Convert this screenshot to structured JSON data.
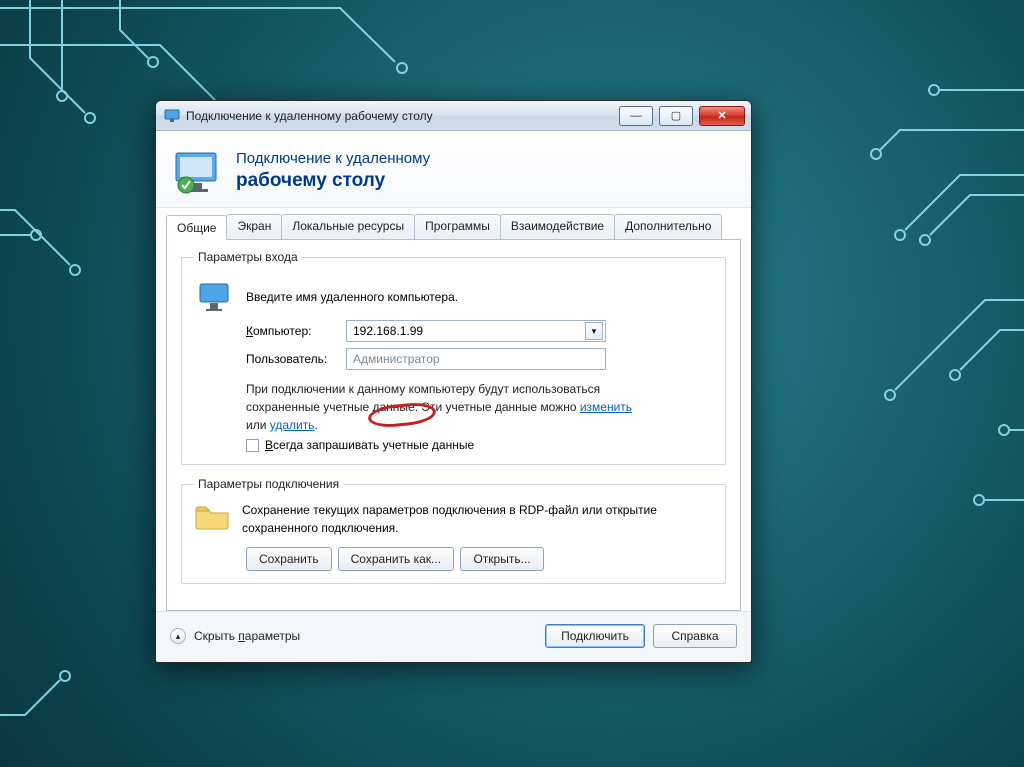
{
  "window": {
    "title": "Подключение к удаленному рабочему столу"
  },
  "header": {
    "line1": "Подключение к удаленному",
    "line2": "рабочему столу"
  },
  "tabs": {
    "general": "Общие",
    "display": "Экран",
    "local": "Локальные ресурсы",
    "programs": "Программы",
    "experience": "Взаимодействие",
    "advanced": "Дополнительно"
  },
  "login": {
    "legend": "Параметры входа",
    "instruction": "Введите имя удаленного компьютера.",
    "computer_label_pre": "К",
    "computer_label_rest": "омпьютер:",
    "computer_value": "192.168.1.99",
    "user_label": "Пользователь:",
    "user_value": "Администратор",
    "info_pre": "При подключении к данному компьютеру будут использоваться сохраненные учетные данные. Эти учетные данные можно ",
    "edit_link": "изменить",
    "info_mid": " или ",
    "delete_link": "удалить",
    "info_post": ".",
    "always_ask_pre": "В",
    "always_ask_rest": "сегда запрашивать учетные данные"
  },
  "connection": {
    "legend": "Параметры подключения",
    "desc": "Сохранение текущих параметров подключения в RDP-файл или открытие сохраненного подключения.",
    "save": "Сохранить",
    "save_as": "Сохранить как...",
    "open": "Открыть..."
  },
  "footer": {
    "hide_pre": "Скрыть ",
    "hide_u": "п",
    "hide_rest": "араметры",
    "connect": "Подключить",
    "help": "Справка"
  }
}
